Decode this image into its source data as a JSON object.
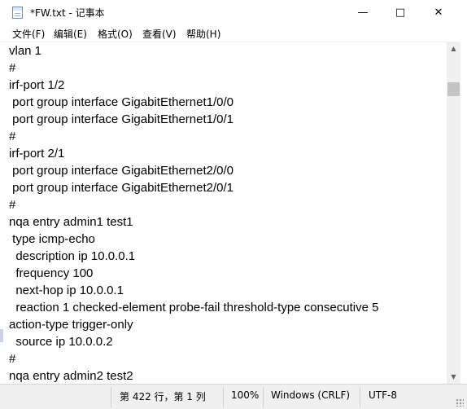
{
  "window": {
    "title": "*FW.txt - 记事本",
    "minimize": "—",
    "maximize": "□",
    "close": "✕"
  },
  "menu": [
    "文件(F)",
    "编辑(E)",
    "格式(O)",
    "查看(V)",
    "帮助(H)"
  ],
  "editor": {
    "lines": [
      "vlan 1",
      "#",
      "irf-port 1/2",
      " port group interface GigabitEthernet1/0/0",
      " port group interface GigabitEthernet1/0/1",
      "#",
      "irf-port 2/1",
      " port group interface GigabitEthernet2/0/0",
      " port group interface GigabitEthernet2/0/1",
      "#",
      "nqa entry admin1 test1",
      " type icmp-echo",
      "  description ip 10.0.0.1",
      "  frequency 100",
      "  next-hop ip 10.0.0.1",
      "  reaction 1 checked-element probe-fail threshold-type consecutive 5",
      "action-type trigger-only",
      "  source ip 10.0.0.2",
      "#",
      "nqa entry admin2 test2"
    ]
  },
  "scrollbar": {
    "up": "▲",
    "down": "▼"
  },
  "status": {
    "position": "第 422 行，第 1 列",
    "zoom": "100%",
    "line_ending": "Windows (CRLF)",
    "encoding": "UTF-8"
  },
  "icons": {
    "app": "notepad-icon",
    "minimize": "minimize-icon",
    "maximize": "maximize-icon",
    "close": "close-icon",
    "resize": "resize-grip-icon"
  }
}
